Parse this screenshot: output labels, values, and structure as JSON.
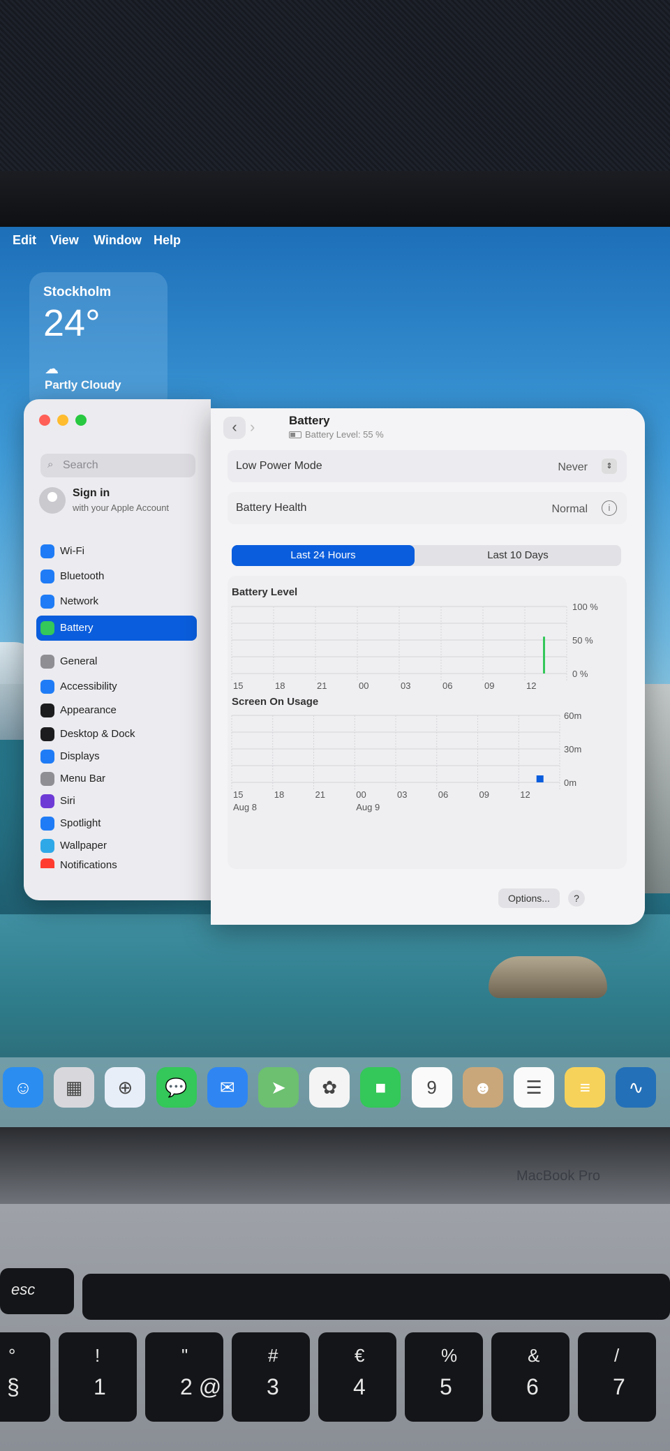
{
  "menubar": {
    "items": [
      "Edit",
      "View",
      "Window",
      "Help"
    ]
  },
  "weather": {
    "city": "Stockholm",
    "temperature": "24°",
    "condition": "Partly Cloudy",
    "icon": "partly-cloudy-icon"
  },
  "sidebar": {
    "search_placeholder": "Search",
    "signin": {
      "title": "Sign in",
      "subtitle": "with your Apple Account"
    },
    "items": [
      {
        "label": "Wi-Fi",
        "icon": "wifi-icon",
        "color": "#1f7cf6"
      },
      {
        "label": "Bluetooth",
        "icon": "bluetooth-icon",
        "color": "#1f7cf6"
      },
      {
        "label": "Network",
        "icon": "globe-icon",
        "color": "#1f7cf6"
      },
      {
        "label": "Battery",
        "icon": "battery-icon",
        "color": "#34c759"
      },
      {
        "label": "General",
        "icon": "gear-icon",
        "color": "#8e8e93"
      },
      {
        "label": "Accessibility",
        "icon": "accessibility-icon",
        "color": "#1f7cf6"
      },
      {
        "label": "Appearance",
        "icon": "appearance-icon",
        "color": "#1c1c1e"
      },
      {
        "label": "Desktop & Dock",
        "icon": "dock-icon",
        "color": "#1c1c1e"
      },
      {
        "label": "Displays",
        "icon": "sun-icon",
        "color": "#1f7cf6"
      },
      {
        "label": "Menu Bar",
        "icon": "menubar-icon",
        "color": "#8e8e93"
      },
      {
        "label": "Siri",
        "icon": "siri-icon",
        "color": "#6e3ad6"
      },
      {
        "label": "Spotlight",
        "icon": "magnifier-icon",
        "color": "#1f7cf6"
      },
      {
        "label": "Wallpaper",
        "icon": "flower-icon",
        "color": "#2fa8e8"
      },
      {
        "label": "Notifications",
        "icon": "bell-icon",
        "color": "#ff3b30"
      }
    ],
    "selected": "Battery"
  },
  "content": {
    "title": "Battery",
    "subtitle": "Battery Level: 55 %",
    "low_power": {
      "label": "Low Power Mode",
      "value": "Never"
    },
    "health": {
      "label": "Battery Health",
      "value": "Normal"
    },
    "tabs": [
      "Last 24 Hours",
      "Last 10 Days"
    ],
    "options_label": "Options...",
    "help_label": "?"
  },
  "chart_data": [
    {
      "type": "bar",
      "title": "Battery Level",
      "categories": [
        "15",
        "18",
        "21",
        "00",
        "03",
        "06",
        "09",
        "12"
      ],
      "ytick_labels": [
        "100 %",
        "50 %",
        "0 %"
      ],
      "ylim": [
        0,
        100
      ],
      "bars": [
        {
          "hour_offset": 22.3,
          "value": 55,
          "color": "#34c759"
        }
      ],
      "grid": true
    },
    {
      "type": "bar",
      "title": "Screen On Usage",
      "categories": [
        "15",
        "18",
        "21",
        "00",
        "03",
        "06",
        "09",
        "12"
      ],
      "date_labels": [
        "Aug 8",
        "Aug 9"
      ],
      "ytick_labels": [
        "60m",
        "30m",
        "0m"
      ],
      "ylim": [
        0,
        60
      ],
      "bars": [
        {
          "hour_offset": 22.3,
          "value": 6,
          "color": "#0a5ddc"
        }
      ],
      "grid": true
    }
  ],
  "dock": [
    {
      "name": "finder-icon",
      "color": "#2b8df0",
      "glyph": "☺"
    },
    {
      "name": "launchpad-icon",
      "color": "#d8d8dc",
      "glyph": "▦"
    },
    {
      "name": "safari-icon",
      "color": "#e8eef8",
      "glyph": "⊕"
    },
    {
      "name": "messages-icon",
      "color": "#34c759",
      "glyph": "💬"
    },
    {
      "name": "mail-icon",
      "color": "#2f86f2",
      "glyph": "✉"
    },
    {
      "name": "maps-icon",
      "color": "#6cc070",
      "glyph": "➤"
    },
    {
      "name": "photos-icon",
      "color": "#f4f4f4",
      "glyph": "✿"
    },
    {
      "name": "facetime-icon",
      "color": "#34c759",
      "glyph": "■"
    },
    {
      "name": "calendar-icon",
      "color": "#fafafa",
      "glyph": "9"
    },
    {
      "name": "contacts-icon",
      "color": "#c9a77a",
      "glyph": "☻"
    },
    {
      "name": "reminders-icon",
      "color": "#fafafa",
      "glyph": "☰"
    },
    {
      "name": "notes-icon",
      "color": "#f7d25a",
      "glyph": "≡"
    },
    {
      "name": "freeform-icon",
      "color": "#2470b8",
      "glyph": "∿"
    }
  ],
  "laptop": {
    "brand": "MacBook Pro"
  },
  "keyboard": {
    "esc": "esc",
    "keys": [
      {
        "top": "°",
        "bottom": "§"
      },
      {
        "top": "!",
        "bottom": "1"
      },
      {
        "top": "\"",
        "bottom": "2 @"
      },
      {
        "top": "#",
        "bottom": "3"
      },
      {
        "top": "€",
        "bottom": "4"
      },
      {
        "top": "%",
        "bottom": "5"
      },
      {
        "top": "&",
        "bottom": "6"
      },
      {
        "top": "/",
        "bottom": "7"
      }
    ]
  }
}
